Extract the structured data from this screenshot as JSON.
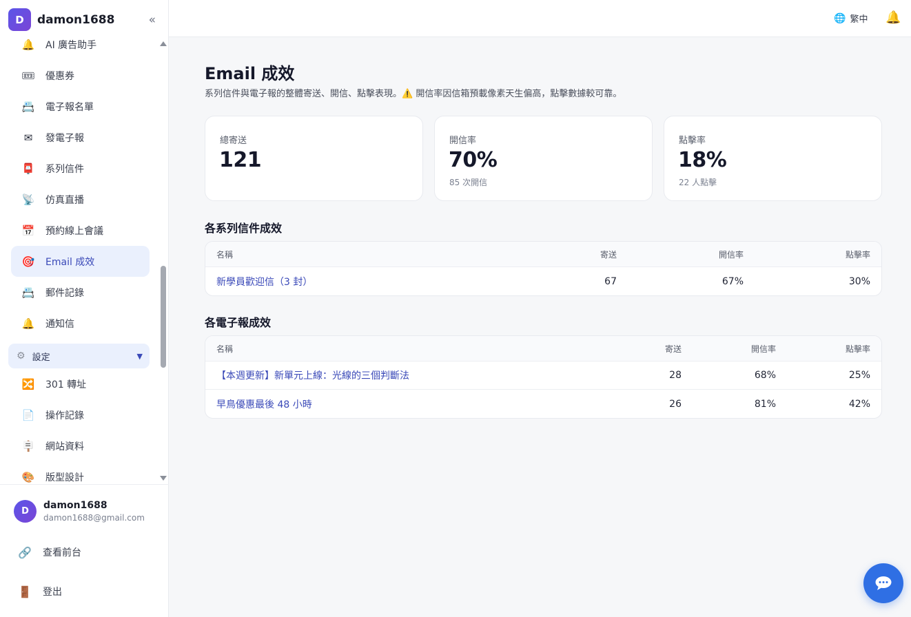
{
  "brand": {
    "avatar_letter": "D",
    "name": "damon1688",
    "collapse": "«"
  },
  "nav": {
    "items": [
      {
        "label": "AI 廣告助手",
        "icon": "🔔"
      },
      {
        "label": "優惠券",
        "icon": "🎟"
      },
      {
        "label": "電子報名單",
        "icon": "📇"
      },
      {
        "label": "發電子報",
        "icon": "✉"
      },
      {
        "label": "系列信件",
        "icon": "📮"
      },
      {
        "label": "仿真直播",
        "icon": "📡"
      },
      {
        "label": "預約線上會議",
        "icon": "📅"
      },
      {
        "label": "Email 成效",
        "icon": "🎯"
      },
      {
        "label": "郵件記錄",
        "icon": "📇"
      },
      {
        "label": "通知信",
        "icon": "🔔"
      }
    ],
    "settings_group": {
      "label": "設定",
      "icon": "⚙",
      "caret": "▼"
    },
    "settings_items": [
      {
        "label": "301 轉址",
        "icon": "🔀"
      },
      {
        "label": "操作記錄",
        "icon": "📄"
      },
      {
        "label": "網站資料",
        "icon": "🪧"
      },
      {
        "label": "版型設計",
        "icon": "🎨"
      }
    ]
  },
  "user": {
    "avatar_letter": "D",
    "name": "damon1688",
    "email": "damon1688@gmail.com",
    "view_site": "查看前台",
    "view_site_icon": "🔗",
    "logout": "登出",
    "logout_icon": "🚪"
  },
  "topbar": {
    "lang_icon": "🌐",
    "lang": "繁中",
    "bell_icon": "🔔"
  },
  "page": {
    "title": "Email 成效",
    "subtitle": "系列信件與電子報的整體寄送、開信、點擊表現。⚠️ 開信率因信箱預載像素天生偏高，點擊數據較可靠。"
  },
  "stats": [
    {
      "label": "總寄送",
      "value": "121",
      "sub": ""
    },
    {
      "label": "開信率",
      "value": "70%",
      "sub": "85 次開信"
    },
    {
      "label": "點擊率",
      "value": "18%",
      "sub": "22 人點擊"
    }
  ],
  "series_section": {
    "title": "各系列信件成效",
    "headers": [
      "名稱",
      "寄送",
      "開信率",
      "點擊率"
    ],
    "rows": [
      {
        "name": "新學員歡迎信（3 封）",
        "sent": "67",
        "open": "67%",
        "click": "30%"
      }
    ]
  },
  "newsletter_section": {
    "title": "各電子報成效",
    "headers": [
      "名稱",
      "寄送",
      "開信率",
      "點擊率"
    ],
    "rows": [
      {
        "name": "【本週更新】新單元上線：光線的三個判斷法",
        "sent": "28",
        "open": "68%",
        "click": "25%"
      },
      {
        "name": "早鳥優惠最後 48 小時",
        "sent": "26",
        "open": "81%",
        "click": "42%"
      }
    ]
  },
  "chat": {
    "icon": "chat-icon"
  }
}
